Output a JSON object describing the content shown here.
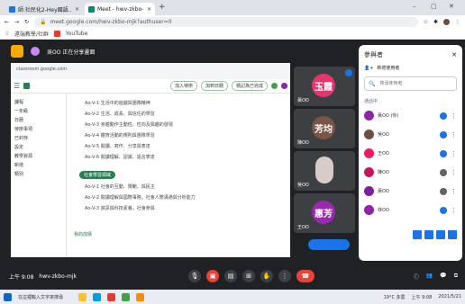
{
  "browser": {
    "tabs": [
      {
        "label": "師.社民化2-Hey國語..."
      },
      {
        "label": "Meet - hwv-zkbo-mjk"
      }
    ],
    "url": "meet.google.com/hwv-zkbo-mjk?authuser=0",
    "bookmarks": [
      "遠端教學/社群",
      "YouTube"
    ]
  },
  "presenter": {
    "label": "吳OO 正在分享畫面"
  },
  "classroom": {
    "tab_url": "classroom.google.com",
    "buttons": [
      "加入待辦",
      "加到日曆",
      "標記為已完成"
    ],
    "nav": [
      "課程",
      "一年級",
      "日曆",
      "待辦事項",
      "已封存",
      "設定",
      "教學資源",
      "新增",
      "類別"
    ],
    "lines": [
      "Ao-V-1 生活中的遊戲與團隊精神",
      "Ao-V-2 生活、成長、與信任的學習",
      "Ao-V-3 身體動作主動性、性向及興趣的發現",
      "Ao-V-4 體育活動的規則與團隊學習",
      "Ao-V-5 閱讀、寫作、分享與表達",
      "Ao-V-6 閱讀理解、認識、語言表達"
    ],
    "section_chip": "社會學習領域",
    "lines2": [
      "Ao-V-1 社會的互動、規範、與民主",
      "Ao-V-2 閱讀理解與國際事務，社會人際溝通與分析能力",
      "Ao-V-3 資訊與科技素養，社會參與"
    ],
    "footer": "我的成績"
  },
  "tiles": [
    {
      "name": "黃OO",
      "initials": "玉霞",
      "color": "#e8336d"
    },
    {
      "name": "陳OO",
      "initials": "芳均",
      "color": "#795548"
    },
    {
      "name": "吳OO",
      "initials": "",
      "color": "#b0bec5"
    },
    {
      "name": "王OO",
      "initials": "惠芳",
      "color": "#9c27b0"
    }
  ],
  "people": {
    "title": "參與者",
    "add": "新增使用者",
    "search_placeholder": "搜尋使用者",
    "section": "通話中",
    "list": [
      {
        "name": "黃OO (你)",
        "color": "#8e24aa"
      },
      {
        "name": "吳OO",
        "color": "#6d4c41"
      },
      {
        "name": "王OO",
        "color": "#e91e63"
      },
      {
        "name": "陳OO",
        "color": "#c2185b"
      },
      {
        "name": "黃OO",
        "color": "#7b1fa2"
      },
      {
        "name": "林OO",
        "color": "#8e24aa"
      }
    ]
  },
  "meeting": {
    "time": "上午 9:08",
    "code": "hwv-zkbo-mjk"
  },
  "taskbar": {
    "search": "在這裡輸入文字來搜尋",
    "weather": "19°C 多雲",
    "clock": "上午 9:08",
    "date": "2021/5/21"
  }
}
